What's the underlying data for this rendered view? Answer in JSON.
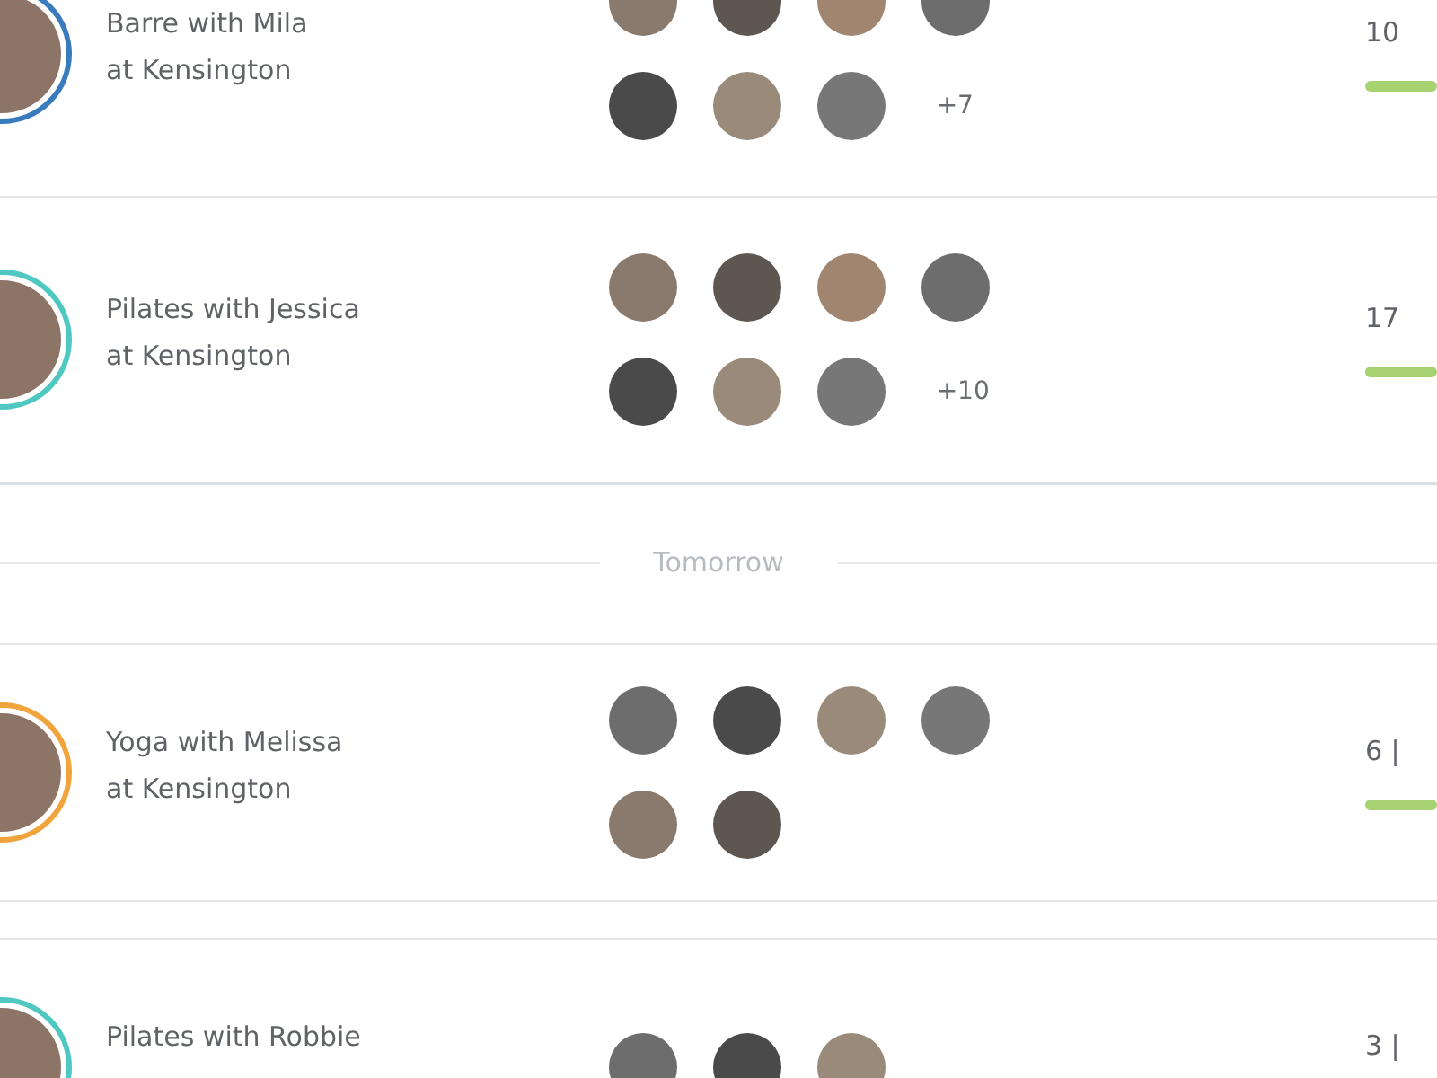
{
  "today_classes": [
    {
      "title": "Barre with Mila",
      "location": "at Kensington",
      "color": "#3a7bbd",
      "attendees": [
        {
          "kind": "photo"
        },
        {
          "kind": "photo"
        },
        {
          "kind": "photo"
        },
        {
          "kind": "photo"
        },
        {
          "kind": "photo"
        },
        {
          "kind": "photo"
        },
        {
          "kind": "photo"
        },
        {
          "kind": "more",
          "label": "+7"
        }
      ],
      "count": "10"
    },
    {
      "title": "Pilates with Jessica",
      "location": "at Kensington",
      "color": "#4ec8c0",
      "attendees": [
        {
          "kind": "photo"
        },
        {
          "kind": "photo"
        },
        {
          "kind": "photo"
        },
        {
          "kind": "photo"
        },
        {
          "kind": "photo"
        },
        {
          "kind": "photo"
        },
        {
          "kind": "photo"
        },
        {
          "kind": "more",
          "label": "+10"
        }
      ],
      "count": "17"
    }
  ],
  "divider": {
    "label": "Tomorrow"
  },
  "tomorrow_classes": [
    {
      "title": "Yoga with Melissa",
      "location": "at Kensington",
      "color": "#f2a43c",
      "attendees": [
        {
          "kind": "photo"
        },
        {
          "kind": "photo"
        },
        {
          "kind": "photo"
        },
        {
          "kind": "photo"
        },
        {
          "kind": "photo"
        },
        {
          "kind": "photo"
        }
      ],
      "count": "6 |"
    },
    {
      "title": "Pilates with Robbie",
      "color": "#4ec8c0",
      "attendees": [
        {
          "kind": "photo"
        },
        {
          "kind": "photo"
        },
        {
          "kind": "photo"
        }
      ],
      "count": "3 |"
    }
  ]
}
